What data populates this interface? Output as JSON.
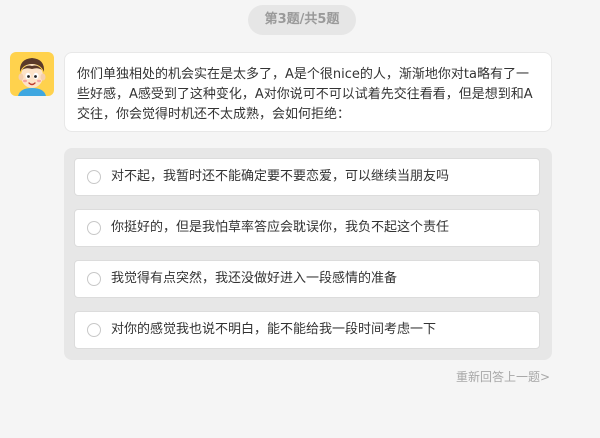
{
  "progress": {
    "text": "第3题/共5题"
  },
  "question": {
    "text": "你们单独相处的机会实在是太多了，A是个很nice的人，渐渐地你对ta略有了一些好感，A感受到了这种变化，A对你说可不可以试着先交往看看，但是想到和A交往，你会觉得时机还不太成熟，会如何拒绝："
  },
  "options": [
    {
      "label": "对不起，我暂时还不能确定要不要恋爱，可以继续当朋友吗"
    },
    {
      "label": "你挺好的，但是我怕草率答应会耽误你，我负不起这个责任"
    },
    {
      "label": "我觉得有点突然，我还没做好进入一段感情的准备"
    },
    {
      "label": "对你的感觉我也说不明白，能不能给我一段时间考虑一下"
    }
  ],
  "footer": {
    "redo_text": "重新回答上一题>"
  },
  "colors": {
    "background": "#f5f5f5",
    "panel": "#e7e7e7",
    "avatar_bg": "#ffd24d",
    "muted_text": "#a8a8a8"
  },
  "icons": {
    "avatar": "cartoon-boy-avatar",
    "option_marker": "radio-circle-icon"
  }
}
